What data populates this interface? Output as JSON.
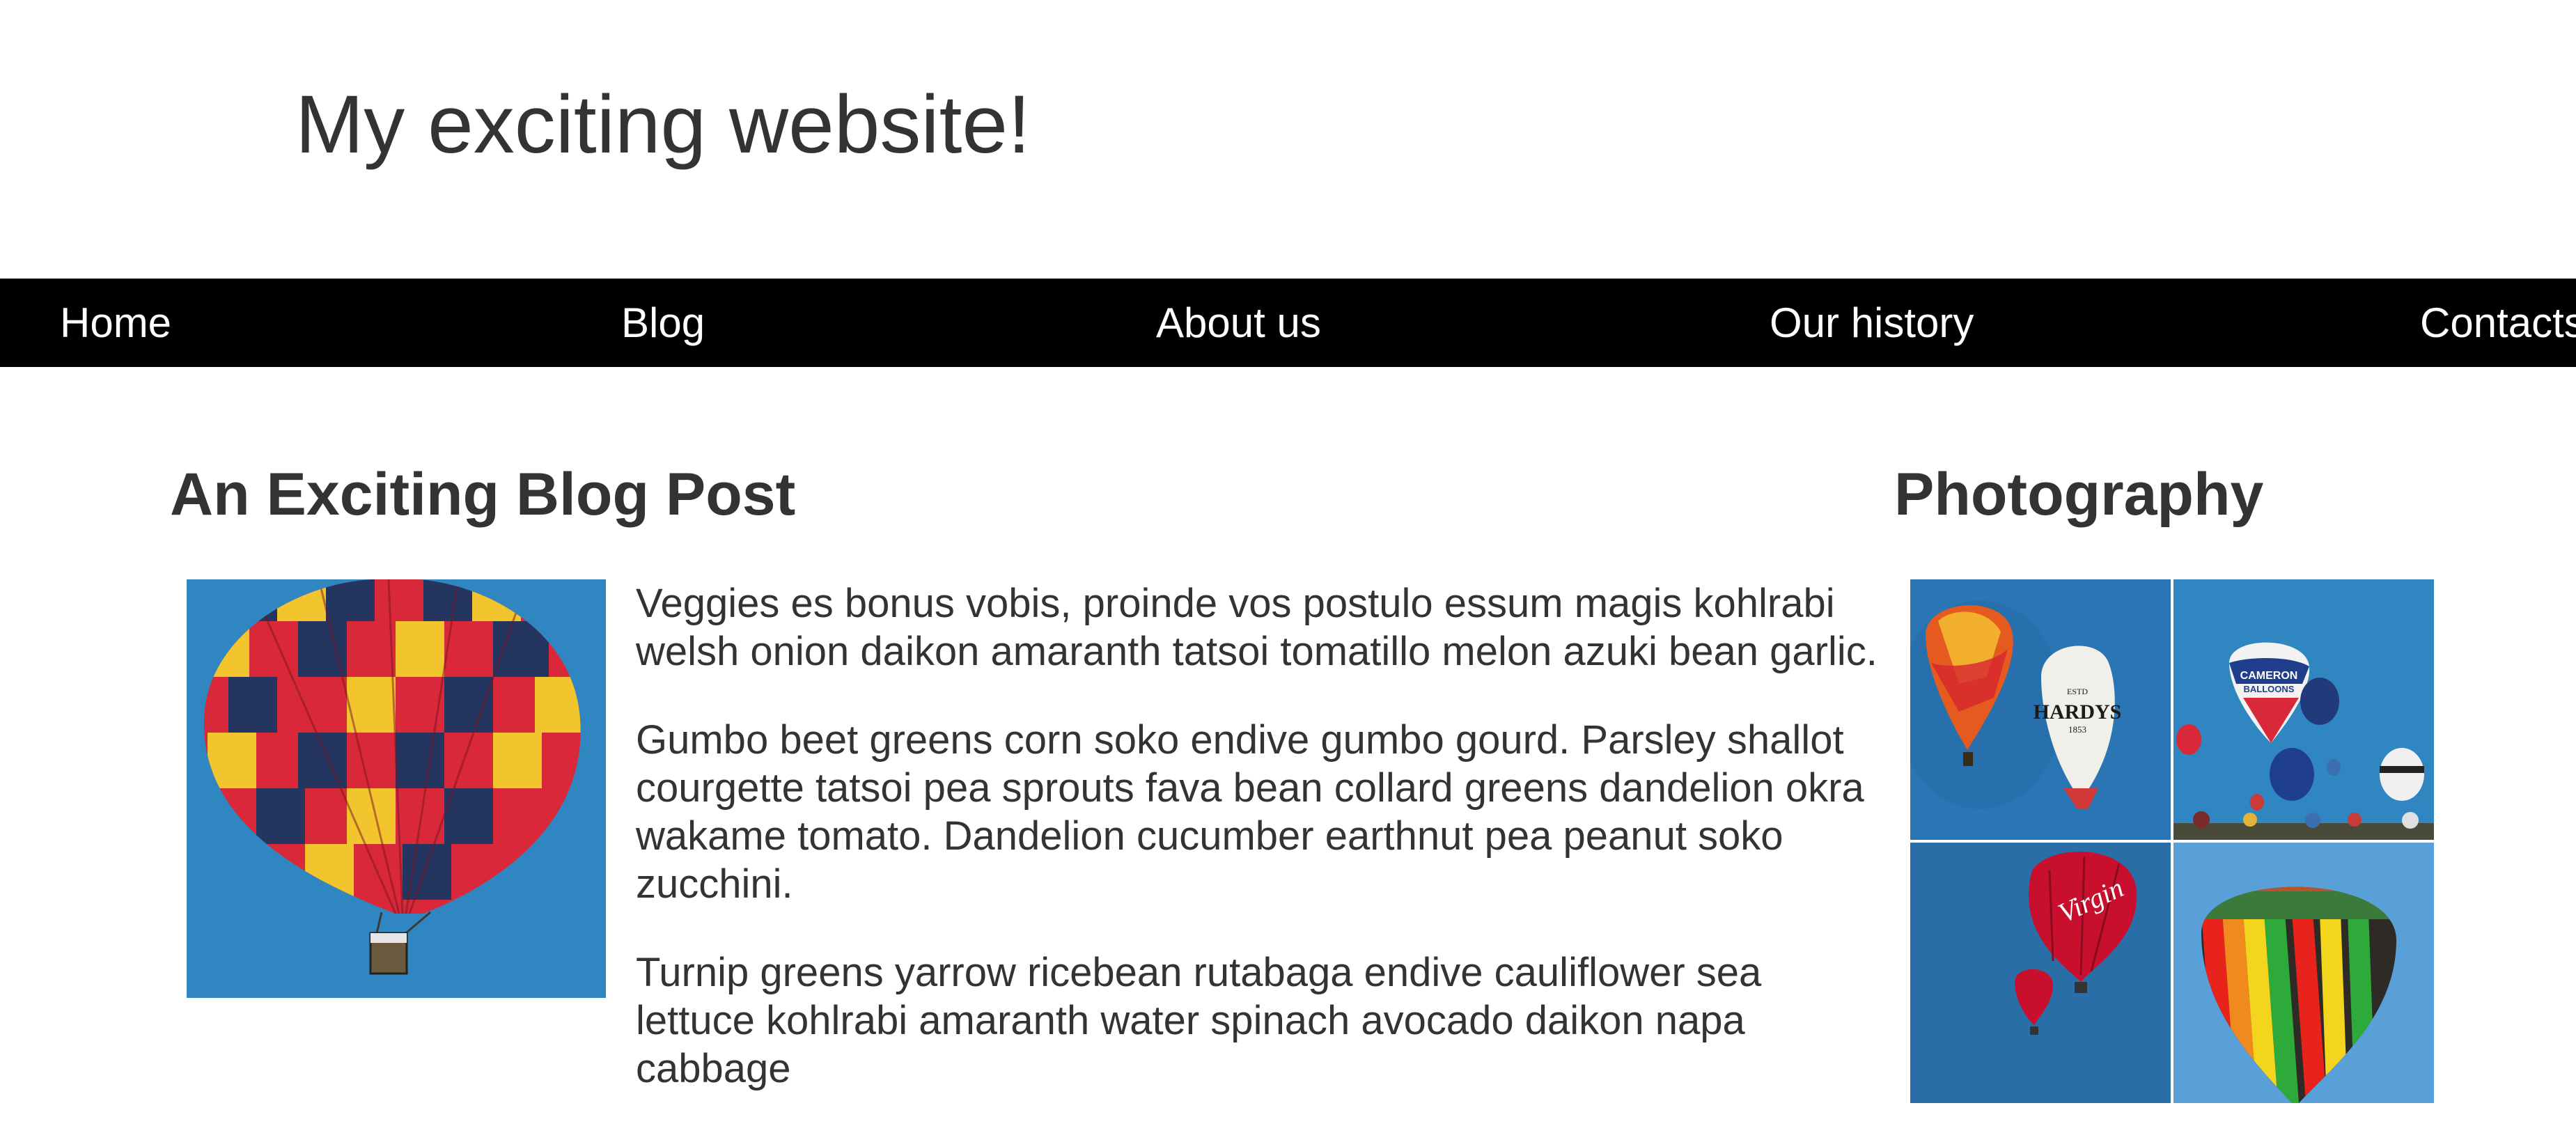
{
  "header": {
    "site_title": "My exciting website!"
  },
  "nav": {
    "items": [
      {
        "label": "Home"
      },
      {
        "label": "Blog"
      },
      {
        "label": "About us"
      },
      {
        "label": "Our history"
      },
      {
        "label": "Contacts"
      }
    ]
  },
  "post": {
    "title": "An Exciting Blog Post",
    "paragraphs": [
      "Veggies es bonus vobis, proinde vos postulo essum magis kohlrabi welsh onion daikon amaranth tatsoi tomatillo melon azuki bean garlic.",
      "Gumbo beet greens corn soko endive gumbo gourd. Parsley shallot courgette tatsoi pea sprouts fava bean collard greens dandelion okra wakame tomato. Dandelion cucumber earthnut pea peanut soko zucchini.",
      "Turnip greens yarrow ricebean rutabaga endive cauliflower sea lettuce kohlrabi amaranth water spinach avocado daikon napa cabbage"
    ]
  },
  "sidebar": {
    "title": "Photography",
    "balloon_texts": {
      "hardys": "HARDYS",
      "estd": "ESTD",
      "year": "1853",
      "cameron": "CAMERON",
      "balloons": "BALLOONS",
      "virgin": "Virgin"
    }
  },
  "colors": {
    "text": "#333333",
    "nav_background": "#000000",
    "nav_text": "#ffffff",
    "sky": "#2f86c0"
  }
}
